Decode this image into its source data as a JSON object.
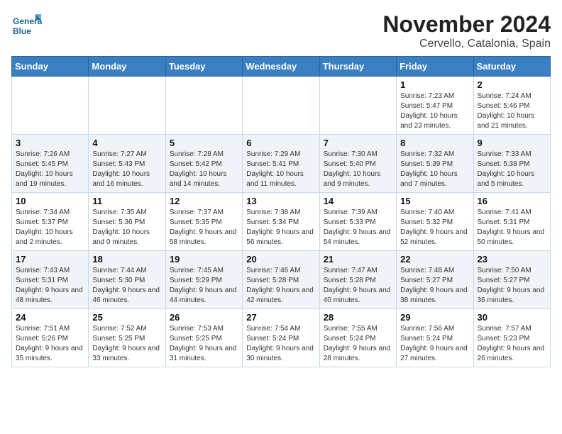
{
  "header": {
    "logo_line1": "General",
    "logo_line2": "Blue",
    "month_title": "November 2024",
    "location": "Cervello, Catalonia, Spain"
  },
  "days_of_week": [
    "Sunday",
    "Monday",
    "Tuesday",
    "Wednesday",
    "Thursday",
    "Friday",
    "Saturday"
  ],
  "weeks": [
    {
      "days": [
        {
          "num": "",
          "info": ""
        },
        {
          "num": "",
          "info": ""
        },
        {
          "num": "",
          "info": ""
        },
        {
          "num": "",
          "info": ""
        },
        {
          "num": "",
          "info": ""
        },
        {
          "num": "1",
          "info": "Sunrise: 7:23 AM\nSunset: 5:47 PM\nDaylight: 10 hours\nand 23 minutes."
        },
        {
          "num": "2",
          "info": "Sunrise: 7:24 AM\nSunset: 5:46 PM\nDaylight: 10 hours\nand 21 minutes."
        }
      ]
    },
    {
      "days": [
        {
          "num": "3",
          "info": "Sunrise: 7:26 AM\nSunset: 5:45 PM\nDaylight: 10 hours\nand 19 minutes."
        },
        {
          "num": "4",
          "info": "Sunrise: 7:27 AM\nSunset: 5:43 PM\nDaylight: 10 hours\nand 16 minutes."
        },
        {
          "num": "5",
          "info": "Sunrise: 7:28 AM\nSunset: 5:42 PM\nDaylight: 10 hours\nand 14 minutes."
        },
        {
          "num": "6",
          "info": "Sunrise: 7:29 AM\nSunset: 5:41 PM\nDaylight: 10 hours\nand 11 minutes."
        },
        {
          "num": "7",
          "info": "Sunrise: 7:30 AM\nSunset: 5:40 PM\nDaylight: 10 hours\nand 9 minutes."
        },
        {
          "num": "8",
          "info": "Sunrise: 7:32 AM\nSunset: 5:39 PM\nDaylight: 10 hours\nand 7 minutes."
        },
        {
          "num": "9",
          "info": "Sunrise: 7:33 AM\nSunset: 5:38 PM\nDaylight: 10 hours\nand 5 minutes."
        }
      ]
    },
    {
      "days": [
        {
          "num": "10",
          "info": "Sunrise: 7:34 AM\nSunset: 5:37 PM\nDaylight: 10 hours\nand 2 minutes."
        },
        {
          "num": "11",
          "info": "Sunrise: 7:35 AM\nSunset: 5:36 PM\nDaylight: 10 hours\nand 0 minutes."
        },
        {
          "num": "12",
          "info": "Sunrise: 7:37 AM\nSunset: 5:35 PM\nDaylight: 9 hours\nand 58 minutes."
        },
        {
          "num": "13",
          "info": "Sunrise: 7:38 AM\nSunset: 5:34 PM\nDaylight: 9 hours\nand 56 minutes."
        },
        {
          "num": "14",
          "info": "Sunrise: 7:39 AM\nSunset: 5:33 PM\nDaylight: 9 hours\nand 54 minutes."
        },
        {
          "num": "15",
          "info": "Sunrise: 7:40 AM\nSunset: 5:32 PM\nDaylight: 9 hours\nand 52 minutes."
        },
        {
          "num": "16",
          "info": "Sunrise: 7:41 AM\nSunset: 5:31 PM\nDaylight: 9 hours\nand 50 minutes."
        }
      ]
    },
    {
      "days": [
        {
          "num": "17",
          "info": "Sunrise: 7:43 AM\nSunset: 5:31 PM\nDaylight: 9 hours\nand 48 minutes."
        },
        {
          "num": "18",
          "info": "Sunrise: 7:44 AM\nSunset: 5:30 PM\nDaylight: 9 hours\nand 46 minutes."
        },
        {
          "num": "19",
          "info": "Sunrise: 7:45 AM\nSunset: 5:29 PM\nDaylight: 9 hours\nand 44 minutes."
        },
        {
          "num": "20",
          "info": "Sunrise: 7:46 AM\nSunset: 5:28 PM\nDaylight: 9 hours\nand 42 minutes."
        },
        {
          "num": "21",
          "info": "Sunrise: 7:47 AM\nSunset: 5:28 PM\nDaylight: 9 hours\nand 40 minutes."
        },
        {
          "num": "22",
          "info": "Sunrise: 7:48 AM\nSunset: 5:27 PM\nDaylight: 9 hours\nand 38 minutes."
        },
        {
          "num": "23",
          "info": "Sunrise: 7:50 AM\nSunset: 5:27 PM\nDaylight: 9 hours\nand 36 minutes."
        }
      ]
    },
    {
      "days": [
        {
          "num": "24",
          "info": "Sunrise: 7:51 AM\nSunset: 5:26 PM\nDaylight: 9 hours\nand 35 minutes."
        },
        {
          "num": "25",
          "info": "Sunrise: 7:52 AM\nSunset: 5:25 PM\nDaylight: 9 hours\nand 33 minutes."
        },
        {
          "num": "26",
          "info": "Sunrise: 7:53 AM\nSunset: 5:25 PM\nDaylight: 9 hours\nand 31 minutes."
        },
        {
          "num": "27",
          "info": "Sunrise: 7:54 AM\nSunset: 5:24 PM\nDaylight: 9 hours\nand 30 minutes."
        },
        {
          "num": "28",
          "info": "Sunrise: 7:55 AM\nSunset: 5:24 PM\nDaylight: 9 hours\nand 28 minutes."
        },
        {
          "num": "29",
          "info": "Sunrise: 7:56 AM\nSunset: 5:24 PM\nDaylight: 9 hours\nand 27 minutes."
        },
        {
          "num": "30",
          "info": "Sunrise: 7:57 AM\nSunset: 5:23 PM\nDaylight: 9 hours\nand 26 minutes."
        }
      ]
    }
  ]
}
